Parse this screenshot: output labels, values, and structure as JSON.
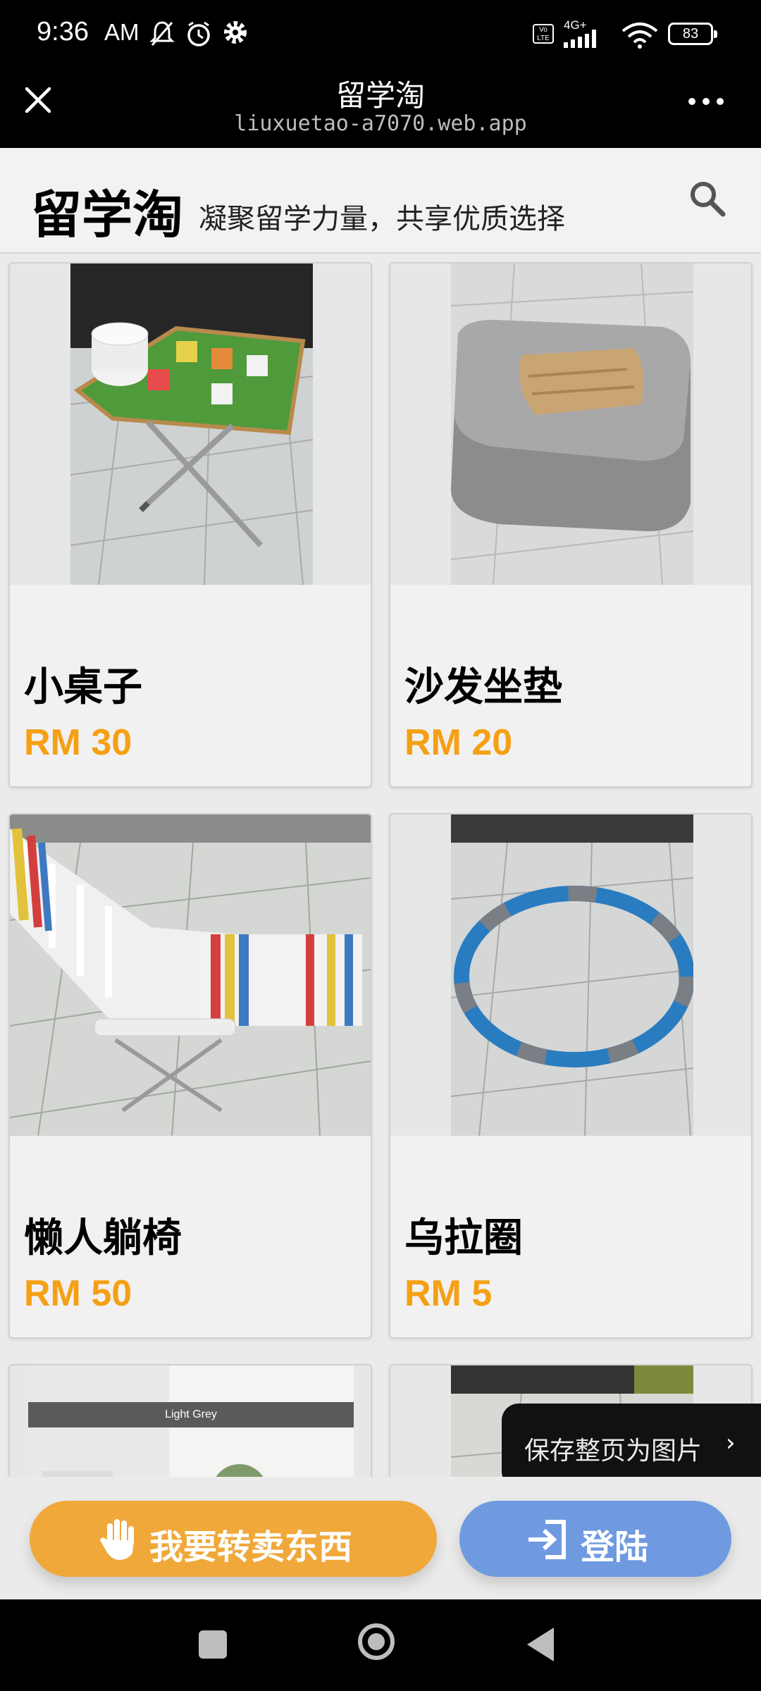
{
  "status_bar": {
    "time": "9:36",
    "ampm": "AM",
    "network": "4G+",
    "volte": "Vo LTE",
    "battery": "83"
  },
  "app_bar": {
    "title": "留学淘",
    "url": "liuxuetao-a7070.web.app"
  },
  "header": {
    "site_name": "留学淘",
    "tagline": "凝聚留学力量，共享优质选择"
  },
  "listings": [
    {
      "title": "小桌子",
      "price": "RM 30"
    },
    {
      "title": "沙发坐垫",
      "price": "RM 20"
    },
    {
      "title": "懒人躺椅",
      "price": "RM 50"
    },
    {
      "title": "乌拉圈",
      "price": "RM 5"
    }
  ],
  "partial_listings": [
    {
      "image_caption": "Light Grey"
    }
  ],
  "toast": {
    "text": "保存整页为图片",
    "chevron": "›"
  },
  "actions": {
    "sell_label": "我要转卖东西",
    "login_label": "登陆"
  },
  "colors": {
    "price": "#f5a014",
    "sell_button": "#f0a83a",
    "login_button": "#6f9ae0"
  }
}
